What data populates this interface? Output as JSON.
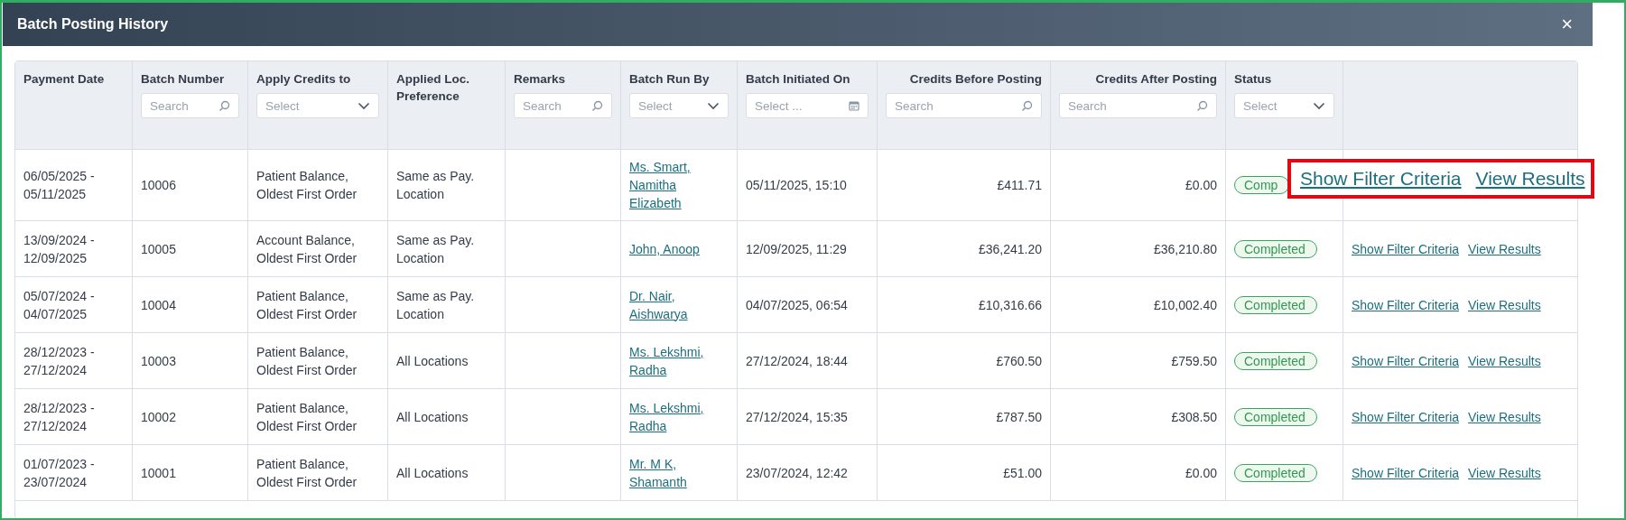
{
  "window": {
    "title": "Batch Posting History",
    "close": "×"
  },
  "columns": [
    {
      "label": "Payment Date"
    },
    {
      "label": "Batch Number",
      "kind": "search",
      "placeholder": "Search"
    },
    {
      "label": "Apply Credits to",
      "kind": "select",
      "placeholder": "Select"
    },
    {
      "label": "Applied Loc. Preference"
    },
    {
      "label": "Remarks",
      "kind": "search",
      "placeholder": "Search"
    },
    {
      "label": "Batch Run By",
      "kind": "select",
      "placeholder": "Select"
    },
    {
      "label": "Batch Initiated On",
      "kind": "date",
      "placeholder": "Select ..."
    },
    {
      "label": "Credits Before Posting",
      "kind": "search",
      "placeholder": "Search"
    },
    {
      "label": "Credits After Posting",
      "kind": "search",
      "placeholder": "Search"
    },
    {
      "label": "Status",
      "kind": "select",
      "placeholder": "Select"
    }
  ],
  "rows": [
    {
      "payment_date": "06/05/2025 - 05/11/2025",
      "batch_number": "10006",
      "apply_credits_to": "Patient Balance, Oldest First Order",
      "loc_preference": "Same as Pay. Location",
      "run_by": "Ms. Smart, Namitha Elizabeth",
      "initiated_on": "05/11/2025, 15:10",
      "credits_before": "£411.71",
      "credits_after": "£0.00",
      "status": "Comp",
      "actions": [
        "Show Filter Criteria",
        "View Results"
      ],
      "highlighted": true
    },
    {
      "payment_date": "13/09/2024 - 12/09/2025",
      "batch_number": "10005",
      "apply_credits_to": "Account Balance, Oldest First Order",
      "loc_preference": "Same as Pay. Location",
      "run_by": "John, Anoop",
      "initiated_on": "12/09/2025, 11:29",
      "credits_before": "£36,241.20",
      "credits_after": "£36,210.80",
      "status": "Completed",
      "actions": [
        "Show Filter Criteria",
        "View Results"
      ],
      "highlighted": false
    },
    {
      "payment_date": "05/07/2024 - 04/07/2025",
      "batch_number": "10004",
      "apply_credits_to": "Patient Balance, Oldest First Order",
      "loc_preference": "Same as Pay. Location",
      "run_by": "Dr. Nair, Aishwarya",
      "initiated_on": "04/07/2025, 06:54",
      "credits_before": "£10,316.66",
      "credits_after": "£10,002.40",
      "status": "Completed",
      "actions": [
        "Show Filter Criteria",
        "View Results"
      ],
      "highlighted": false
    },
    {
      "payment_date": "28/12/2023 - 27/12/2024",
      "batch_number": "10003",
      "apply_credits_to": "Patient Balance, Oldest First Order",
      "loc_preference": "All Locations",
      "run_by": "Ms. Lekshmi, Radha",
      "initiated_on": "27/12/2024, 18:44",
      "credits_before": "£760.50",
      "credits_after": "£759.50",
      "status": "Completed",
      "actions": [
        "Show Filter Criteria",
        "View Results"
      ],
      "highlighted": false
    },
    {
      "payment_date": "28/12/2023 - 27/12/2024",
      "batch_number": "10002",
      "apply_credits_to": "Patient Balance, Oldest First Order",
      "loc_preference": "All Locations",
      "run_by": "Ms. Lekshmi, Radha",
      "initiated_on": "27/12/2024, 15:35",
      "credits_before": "£787.50",
      "credits_after": "£308.50",
      "status": "Completed",
      "actions": [
        "Show Filter Criteria",
        "View Results"
      ],
      "highlighted": false
    },
    {
      "payment_date": "01/07/2023 - 23/07/2024",
      "batch_number": "10001",
      "apply_credits_to": "Patient Balance, Oldest First Order",
      "loc_preference": "All Locations",
      "run_by": "Mr. M K, Shamanth",
      "initiated_on": "23/07/2024, 12:42",
      "credits_before": "£51.00",
      "credits_after": "£0.00",
      "status": "Completed",
      "actions": [
        "Show Filter Criteria",
        "View Results"
      ],
      "highlighted": false
    }
  ]
}
